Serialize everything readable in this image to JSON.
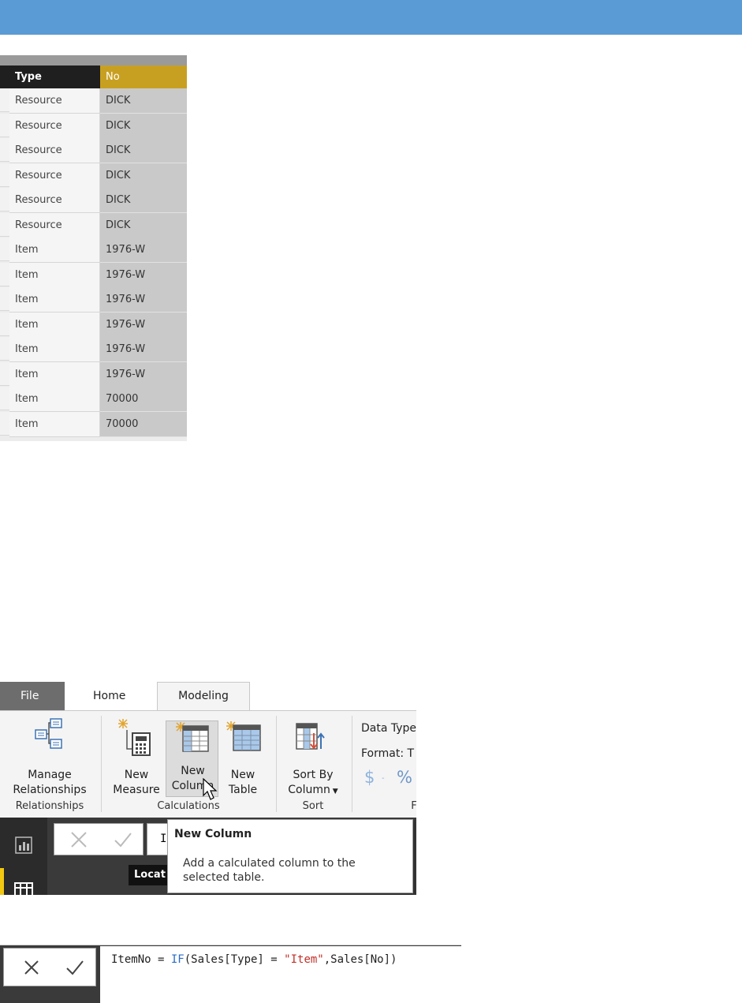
{
  "table": {
    "headers": {
      "type": "Type",
      "no": "No"
    },
    "rows": [
      {
        "type": "Resource",
        "no": "DICK"
      },
      {
        "type": "Resource",
        "no": "DICK"
      },
      {
        "type": "Resource",
        "no": "DICK"
      },
      {
        "type": "Resource",
        "no": "DICK"
      },
      {
        "type": "Resource",
        "no": "DICK"
      },
      {
        "type": "Resource",
        "no": "DICK"
      },
      {
        "type": "Item",
        "no": "1976-W"
      },
      {
        "type": "Item",
        "no": "1976-W"
      },
      {
        "type": "Item",
        "no": "1976-W"
      },
      {
        "type": "Item",
        "no": "1976-W"
      },
      {
        "type": "Item",
        "no": "1976-W"
      },
      {
        "type": "Item",
        "no": "1976-W"
      },
      {
        "type": "Item",
        "no": "70000"
      },
      {
        "type": "Item",
        "no": "70000"
      }
    ]
  },
  "ribbon": {
    "tabs": {
      "file": "File",
      "home": "Home",
      "modeling": "Modeling"
    },
    "buttons": {
      "manage_l1": "Manage",
      "manage_l2": "Relationships",
      "measure_l1": "New",
      "measure_l2": "Measure",
      "column_l1": "New",
      "column_l2": "Column",
      "table_l1": "New",
      "table_l2": "Table",
      "sort_l1": "Sort By",
      "sort_l2": "Column"
    },
    "groups": {
      "relationships": "Relationships",
      "calculations": "Calculations",
      "sort": "Sort",
      "formatting_partial": "F"
    },
    "formatting": {
      "data_type": "Data Type",
      "format": "Format: T",
      "currency": "$",
      "percent": "%"
    },
    "formula_input_partial": "I",
    "column_header_partial": "Locat",
    "tooltip": {
      "title": "New Column",
      "description": "Add a calculated column to the selected table."
    }
  },
  "formula": {
    "prefix": "ItemNo = ",
    "func": "IF",
    "open": "(Sales[Type] = ",
    "literal": "\"Item\"",
    "rest": ",Sales[No])"
  },
  "colors": {
    "topbar": "#5b9bd5",
    "header_dark": "#1f1f1f",
    "header_gold": "#c8a021",
    "keyword_blue": "#2b6cc4",
    "string_red": "#c0302a"
  },
  "icons": [
    "manage-relationships-icon",
    "new-measure-icon",
    "new-column-icon",
    "new-table-icon",
    "sort-by-column-icon",
    "report-view-icon",
    "data-view-icon",
    "cancel-icon",
    "commit-icon",
    "mouse-cursor-icon"
  ]
}
